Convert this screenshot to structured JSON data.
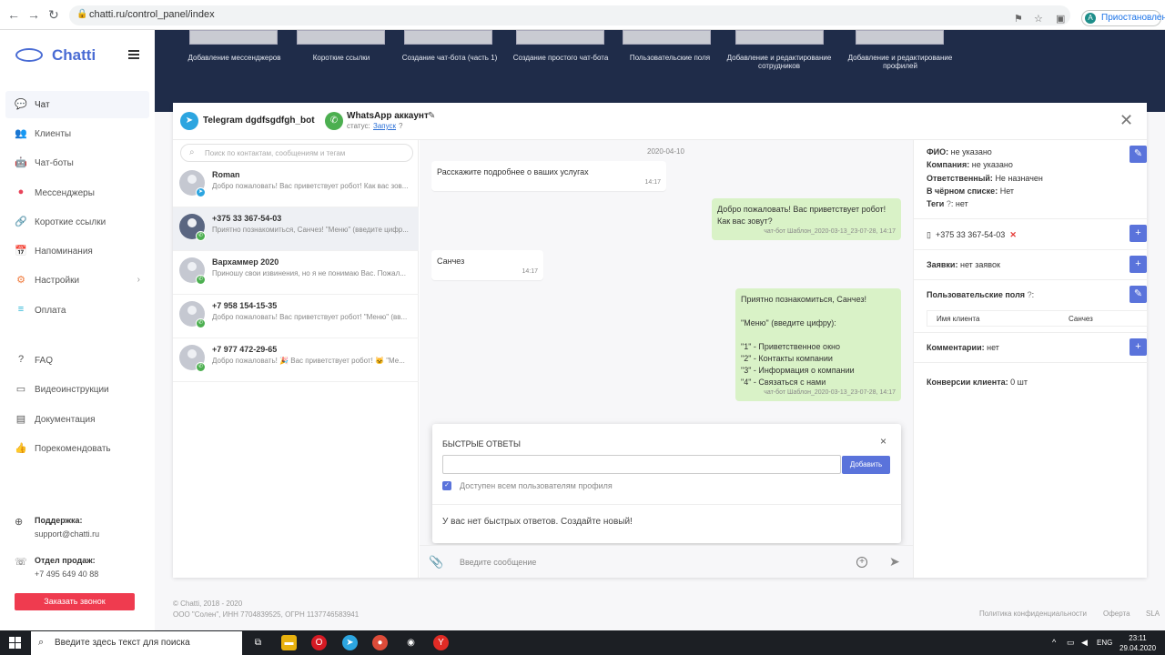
{
  "browser": {
    "url": "chatti.ru/control_panel/index",
    "profile_initial": "A",
    "profile_label": "Приостановлена",
    "back": "←",
    "forward": "→",
    "reload": "↻"
  },
  "sidebar": {
    "brand": "Chatti",
    "items": [
      {
        "label": "Чат",
        "icon": "💬"
      },
      {
        "label": "Клиенты",
        "icon": "👥"
      },
      {
        "label": "Чат-боты",
        "icon": "🤖"
      },
      {
        "label": "Мессенджеры",
        "icon": "●"
      },
      {
        "label": "Короткие ссылки",
        "icon": "🔗"
      },
      {
        "label": "Напоминания",
        "icon": "📅"
      },
      {
        "label": "Настройки",
        "icon": "⚙"
      },
      {
        "label": "Оплата",
        "icon": "≡"
      },
      {
        "label": "FAQ",
        "icon": "?"
      },
      {
        "label": "Видеоинструкции",
        "icon": "▭"
      },
      {
        "label": "Документация",
        "icon": "▤"
      },
      {
        "label": "Порекомендовать",
        "icon": "👍"
      }
    ],
    "settings_chevron": "›",
    "support_title": "Поддержка:",
    "support_value": "support@chatti.ru",
    "sales_title": "Отдел продаж:",
    "sales_value": "+7 495 649 40 88",
    "call_button": "Заказать звонок"
  },
  "banner": {
    "items": [
      "Добавление мессенджеров",
      "Короткие ссылки",
      "Создание чат-бота (часть 1)",
      "Создание простого чат-бота",
      "Пользовательские поля",
      "Добавление и редактирование сотрудников",
      "Добавление и редактирование профилей"
    ]
  },
  "chat_header": {
    "telegram_bot": "Telegram dgdfsgdfgh_bot",
    "whatsapp_title": "WhatsApp аккаунт",
    "status_label": "статус:",
    "status_link": "Запуск",
    "close": "✕"
  },
  "contacts": {
    "search_placeholder": "Поиск по контактам, сообщениям и тегам",
    "items": [
      {
        "name": "Roman",
        "preview": "Добро пожаловать! Вас приветствует робот! Как вас зов...",
        "channel": "tg"
      },
      {
        "name": "+375 33 367-54-03",
        "preview": "Приятно познакомиться, Санчез! \"Меню\" (введите цифр...",
        "channel": "wa"
      },
      {
        "name": "Вархаммер 2020",
        "preview": "Приношу свои извинения, но я не понимаю Вас. Пожал...",
        "channel": "wa"
      },
      {
        "name": "+7 958 154-15-35",
        "preview": "Добро пожаловать! Вас приветствует робот! \"Меню\" (вв...",
        "channel": "wa"
      },
      {
        "name": "+7 977 472-29-65",
        "preview": "Добро пожаловать! 🎉 Вас приветствует робот! 🐱 \"Ме...",
        "channel": "wa"
      }
    ]
  },
  "messages": {
    "date": "2020-04-10",
    "list": [
      {
        "text": "Расскажите подробнее о ваших услугах",
        "meta": "14:17"
      },
      {
        "text": "Добро пожаловать! Вас приветствует робот!\nКак вас зовут?",
        "meta": "чат-бот Шаблон_2020-03-13_23-07-28, 14:17"
      },
      {
        "text": "Санчез",
        "meta": "14:17"
      },
      {
        "text": "Приятно познакомиться, Санчез!\n\n\"Меню\" (введите цифру):\n\n\"1\" - Приветственное окно\n\"2\" - Контакты компании\n\"3\" - Информация о компании\n\"4\" - Связаться с нами",
        "meta": "чат-бот Шаблон_2020-03-13_23-07-28, 14:17"
      }
    ]
  },
  "quick_replies": {
    "title": "БЫСТРЫЕ ОТВЕТЫ",
    "add_button": "Добавить",
    "checkbox_label": "Доступен всем пользователям профиля",
    "checkbox_checked": true,
    "empty_text": "У вас нет быстрых ответов. Создайте новый!",
    "close": "×"
  },
  "composer": {
    "placeholder": "Введите сообщение"
  },
  "client": {
    "fio_label": "ФИО:",
    "fio_value": "не указано",
    "company_label": "Компания:",
    "company_value": "не указано",
    "responsible_label": "Ответственный:",
    "responsible_value": "Не назначен",
    "blacklist_label": "В чёрном списке:",
    "blacklist_value": "Нет",
    "tags_label": "Теги",
    "tags_value": "нет",
    "phone": "+375 33 367-54-03",
    "requests_label": "Заявки:",
    "requests_value": "нет заявок",
    "custom_fields_label": "Пользовательские поля",
    "custom_field_name": "Имя клиента",
    "custom_field_value": "Санчез",
    "comments_label": "Комментарии:",
    "comments_value": "нет",
    "conversions_label": "Конверсии клиента:",
    "conversions_value": "0 шт"
  },
  "footer": {
    "copyright": "© Chatti, 2018 - 2020",
    "legal": "ООО \"Солен\", ИНН 7704839525, ОГРН 1137746583941",
    "privacy": "Политика конфиденциальности",
    "offer": "Оферта",
    "sla": "SLA"
  },
  "taskbar": {
    "search_placeholder": "Введите здесь текст для поиска",
    "lang": "ENG",
    "time": "23:11",
    "date": "29.04.2020"
  },
  "colors": {
    "accent": "#5a73db",
    "banner": "#1f2c49",
    "outgoing_bubble": "#d9f2c7",
    "call_button": "#ef3b4f"
  }
}
